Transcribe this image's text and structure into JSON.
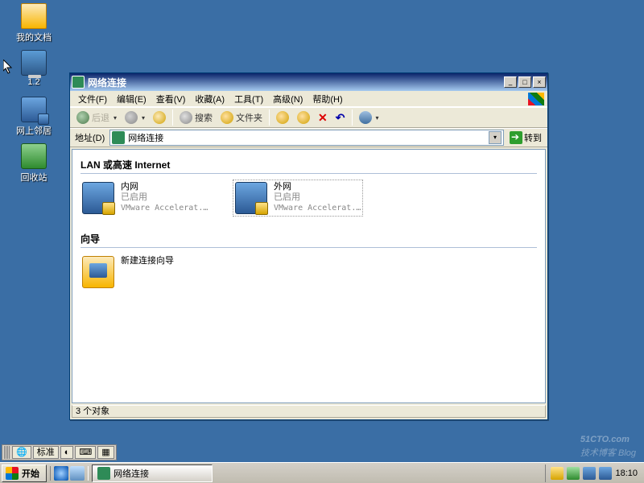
{
  "desktop": {
    "icons": [
      {
        "name": "my-documents",
        "label": "我的文档"
      },
      {
        "name": "computer-1-2",
        "label": "1.2"
      },
      {
        "name": "network-places",
        "label": "网上邻居"
      },
      {
        "name": "recycle-bin",
        "label": "回收站"
      }
    ]
  },
  "window": {
    "title": "网络连接",
    "menu": {
      "file": "文件(F)",
      "edit": "编辑(E)",
      "view": "查看(V)",
      "favorites": "收藏(A)",
      "tools": "工具(T)",
      "advanced": "高级(N)",
      "help": "帮助(H)"
    },
    "toolbar": {
      "back": "后退",
      "search": "搜索",
      "folders": "文件夹"
    },
    "addressbar": {
      "label": "地址(D)",
      "value": "网络连接",
      "go": "转到"
    },
    "groups": {
      "lan": "LAN 或高速 Internet",
      "wizard": "向导"
    },
    "connections": [
      {
        "name": "内网",
        "status": "已启用",
        "detail": "VMware Accelerat..."
      },
      {
        "name": "外网",
        "status": "已启用",
        "detail": "VMware Accelerat..."
      }
    ],
    "wizard_item": "新建连接向导",
    "status": "3 个对象"
  },
  "ime": {
    "label1": "标准",
    "icon_globe": "🌐",
    "icon_moon": "◐",
    "icon_kbd": "⌨",
    "icon_box": "▦"
  },
  "taskbar": {
    "start": "开始",
    "task_label": "网络连接",
    "clock": "18:10"
  },
  "watermark": {
    "main": "51CTO.com",
    "sub": "技术博客 Blog"
  }
}
